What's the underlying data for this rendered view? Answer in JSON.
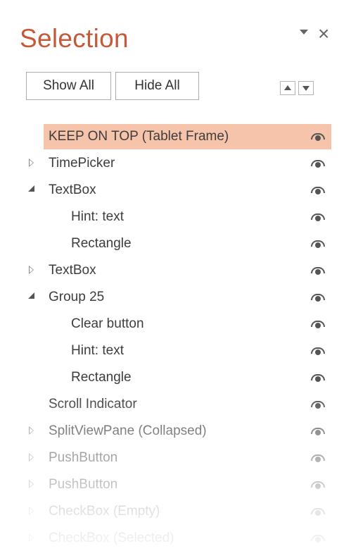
{
  "pane": {
    "title": "Selection",
    "show_all_label": "Show All",
    "hide_all_label": "Hide All"
  },
  "items": [
    {
      "label": "KEEP ON TOP (Tablet Frame)",
      "level": 0,
      "expander": "none",
      "selected": true,
      "visible": true
    },
    {
      "label": "TimePicker",
      "level": 0,
      "expander": "collapsed",
      "selected": false,
      "visible": true
    },
    {
      "label": "TextBox",
      "level": 0,
      "expander": "expanded",
      "selected": false,
      "visible": true
    },
    {
      "label": "Hint: text",
      "level": 1,
      "expander": "none",
      "selected": false,
      "visible": true
    },
    {
      "label": "Rectangle",
      "level": 1,
      "expander": "none",
      "selected": false,
      "visible": true
    },
    {
      "label": "TextBox",
      "level": 0,
      "expander": "collapsed",
      "selected": false,
      "visible": true
    },
    {
      "label": "Group 25",
      "level": 0,
      "expander": "expanded",
      "selected": false,
      "visible": true
    },
    {
      "label": "Clear button",
      "level": 1,
      "expander": "none",
      "selected": false,
      "visible": true
    },
    {
      "label": "Hint: text",
      "level": 1,
      "expander": "none",
      "selected": false,
      "visible": true
    },
    {
      "label": "Rectangle",
      "level": 1,
      "expander": "none",
      "selected": false,
      "visible": true
    },
    {
      "label": "Scroll Indicator",
      "level": 0,
      "expander": "none",
      "selected": false,
      "visible": true
    },
    {
      "label": "SplitViewPane (Collapsed)",
      "level": 0,
      "expander": "collapsed",
      "selected": false,
      "visible": true
    },
    {
      "label": "PushButton",
      "level": 0,
      "expander": "collapsed",
      "selected": false,
      "visible": true
    },
    {
      "label": "PushButton",
      "level": 0,
      "expander": "collapsed",
      "selected": false,
      "visible": true
    },
    {
      "label": "CheckBox (Empty)",
      "level": 0,
      "expander": "collapsed",
      "selected": false,
      "visible": true
    },
    {
      "label": "CheckBox (Selected)",
      "level": 0,
      "expander": "collapsed",
      "selected": false,
      "visible": true
    }
  ],
  "colors": {
    "title": "#c55a3a",
    "selection_highlight": "#f6c4aa"
  }
}
